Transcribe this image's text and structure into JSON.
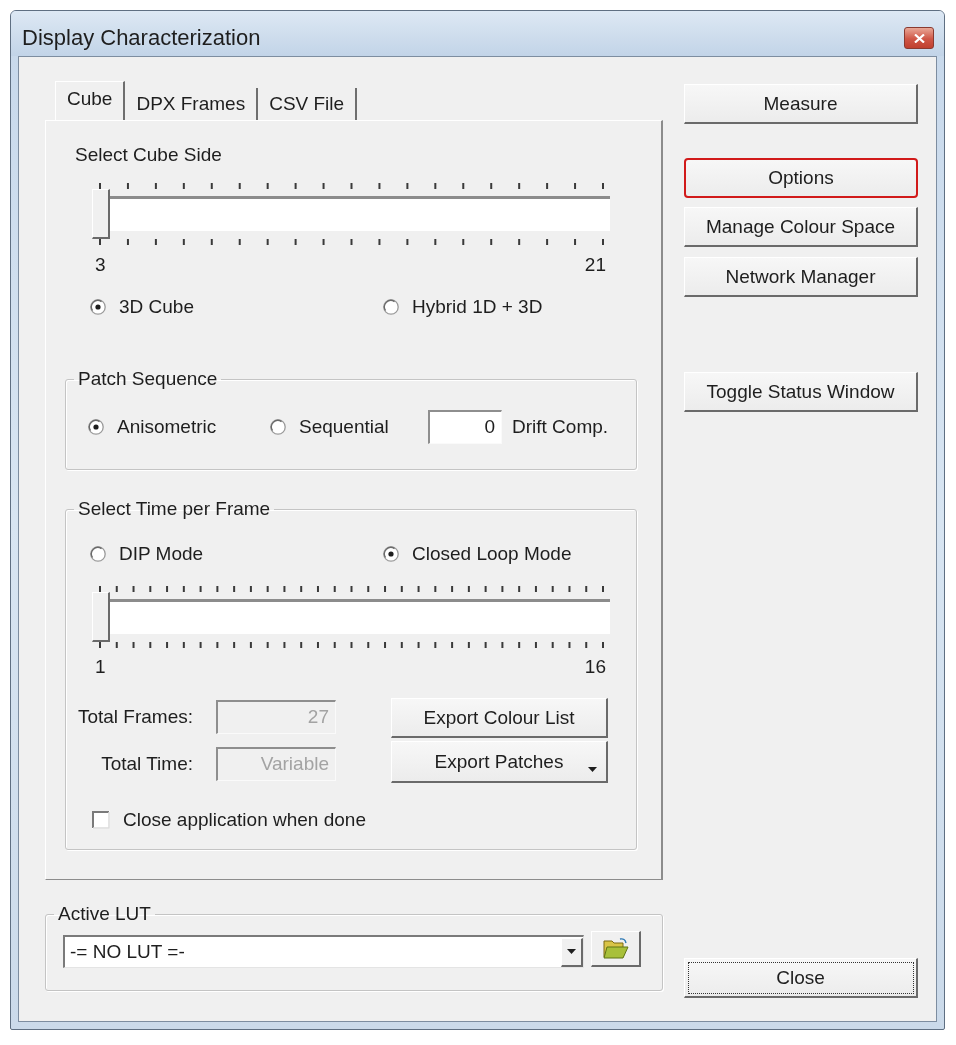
{
  "window": {
    "title": "Display Characterization"
  },
  "tabs": [
    {
      "label": "Cube",
      "selected": true
    },
    {
      "label": "DPX Frames",
      "selected": false
    },
    {
      "label": "CSV File",
      "selected": false
    }
  ],
  "cube_side": {
    "title": "Select Cube Side",
    "slider": {
      "level": 0,
      "min_label": "3",
      "max_label": "21"
    },
    "options": [
      {
        "label": "3D Cube",
        "selected": true
      },
      {
        "label": "Hybrid 1D + 3D",
        "selected": false
      }
    ]
  },
  "patch_sequence": {
    "title": "Patch Sequence",
    "options": [
      {
        "label": "Anisometric",
        "selected": true
      },
      {
        "label": "Sequential",
        "selected": false
      }
    ],
    "drift_field": {
      "value": "0",
      "label": "Drift Comp."
    }
  },
  "time_per_frame": {
    "title": "Select Time per Frame",
    "options": [
      {
        "label": "DIP Mode",
        "selected": false
      },
      {
        "label": "Closed Loop Mode",
        "selected": true
      }
    ],
    "slider": {
      "level": 0,
      "min_label": "1",
      "max_label": "16"
    },
    "fields": [
      {
        "label": "Total Frames:",
        "value": "27",
        "disabled": true
      },
      {
        "label": "Total Time:",
        "value": "Variable",
        "disabled": true
      }
    ],
    "buttons": [
      {
        "label": "Export Colour List",
        "kind": "plain"
      },
      {
        "label": "Export Patches",
        "kind": "dropdown"
      }
    ],
    "close_when_done": {
      "label": "Close application when done",
      "checked": false
    }
  },
  "active_lut": {
    "title": "Active LUT",
    "value": "-= NO LUT =-"
  },
  "side_buttons": [
    {
      "label": "Measure",
      "highlighted": false
    },
    {
      "label": "Options",
      "highlighted": true
    },
    {
      "label": "Manage Colour Space",
      "highlighted": false
    },
    {
      "label": "Network Manager",
      "highlighted": false
    },
    {
      "label": "Toggle Status Window",
      "highlighted": false
    }
  ],
  "close_button": {
    "label": "Close",
    "focused": true
  }
}
